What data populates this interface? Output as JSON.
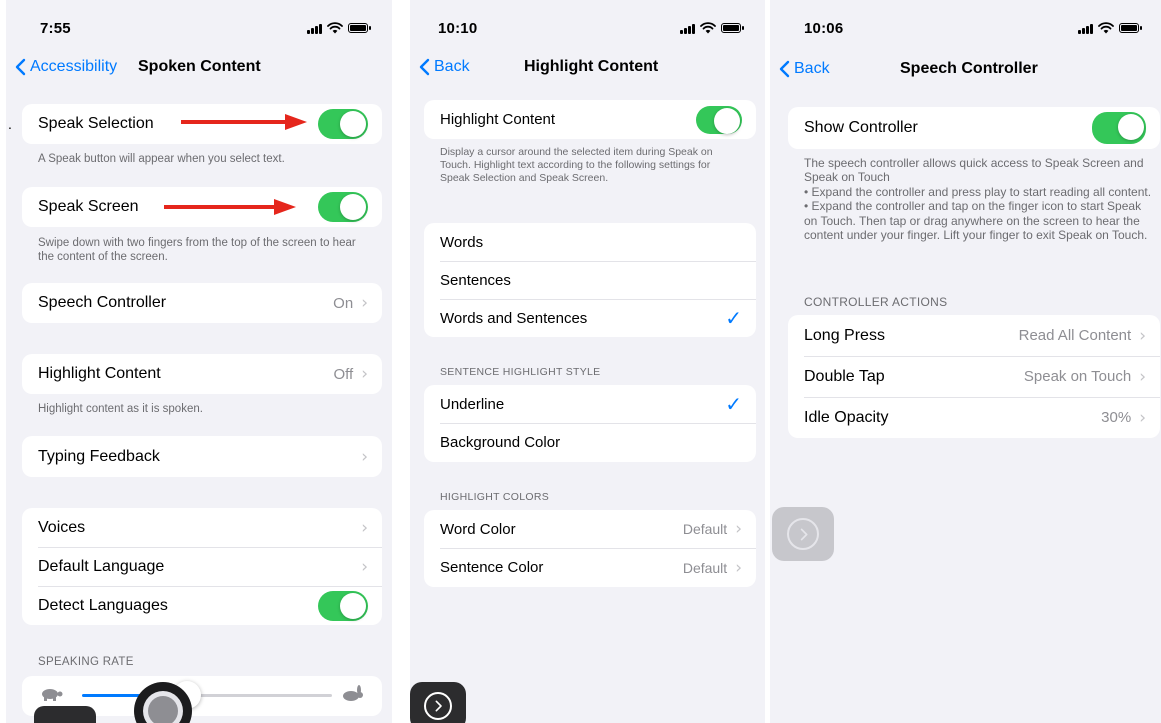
{
  "panel1": {
    "status_time": "7:55",
    "back_label": "Accessibility",
    "title": "Spoken Content",
    "speak_selection_label": "Speak Selection",
    "speak_selection_footer": "A Speak button will appear when you select text.",
    "speak_screen_label": "Speak Screen",
    "speak_screen_footer": "Swipe down with two fingers from the top of the screen to hear the content of the screen.",
    "speech_controller_label": "Speech Controller",
    "speech_controller_value": "On",
    "highlight_content_label": "Highlight Content",
    "highlight_content_value": "Off",
    "highlight_content_footer": "Highlight content as it is spoken.",
    "typing_feedback_label": "Typing Feedback",
    "voices_label": "Voices",
    "default_language_label": "Default Language",
    "detect_languages_label": "Detect Languages",
    "speaking_rate_header": "SPEAKING RATE",
    "speaking_rate_fraction": 0.42
  },
  "panel2": {
    "status_time": "10:10",
    "back_label": "Back",
    "title": "Highlight Content",
    "highlight_content_label": "Highlight Content",
    "highlight_footer": "Display a cursor around the selected item during Speak on Touch. Highlight text according to the following settings for Speak Selection and Speak Screen.",
    "modes": [
      "Words",
      "Sentences",
      "Words and Sentences"
    ],
    "style_header": "SENTENCE HIGHLIGHT STYLE",
    "styles": [
      "Underline",
      "Background Color"
    ],
    "colors_header": "HIGHLIGHT COLORS",
    "word_color_label": "Word Color",
    "word_color_value": "Default",
    "sentence_color_label": "Sentence Color",
    "sentence_color_value": "Default"
  },
  "panel3": {
    "status_time": "10:06",
    "back_label": "Back",
    "title": "Speech Controller",
    "show_controller_label": "Show Controller",
    "controller_footer_intro": "The speech controller allows quick access to Speak Screen and Speak on Touch",
    "controller_footer_bullet1": "• Expand the controller and press play to start reading all content.",
    "controller_footer_bullet2": "• Expand the controller and tap on the finger icon to start Speak on Touch. Then tap or drag anywhere on the screen to hear the content under your finger. Lift your finger to exit Speak on Touch.",
    "actions_header": "CONTROLLER ACTIONS",
    "long_press_label": "Long Press",
    "long_press_value": "Read All Content",
    "double_tap_label": "Double Tap",
    "double_tap_value": "Speak on Touch",
    "idle_opacity_label": "Idle Opacity",
    "idle_opacity_value": "30%"
  },
  "glyphs": {
    "chevron": "›",
    "check": "✓"
  },
  "colors": {
    "accent": "#007aff",
    "toggle_on": "#34c759",
    "annotation_arrow": "#e5261c"
  }
}
